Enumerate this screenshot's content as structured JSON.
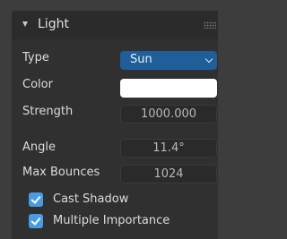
{
  "panel": {
    "title": "Light"
  },
  "properties": {
    "type": {
      "label": "Type",
      "value": "Sun"
    },
    "color": {
      "label": "Color",
      "value_hex": "#ffffff"
    },
    "strength": {
      "label": "Strength",
      "value": "1000.000"
    },
    "angle": {
      "label": "Angle",
      "value": "11.4°"
    },
    "max_bounces": {
      "label": "Max Bounces",
      "value": "1024"
    }
  },
  "checkboxes": [
    {
      "label": "Cast Shadow",
      "checked": true
    },
    {
      "label": "Multiple Importance",
      "checked": true
    }
  ],
  "colors": {
    "accent": "#4a9be6",
    "selected_field": "#1f5e99"
  },
  "icons": {
    "collapse": "chevron-down-icon",
    "grip": "grip-icon",
    "dropdown": "chevron-down-icon",
    "check": "checkmark-icon"
  }
}
